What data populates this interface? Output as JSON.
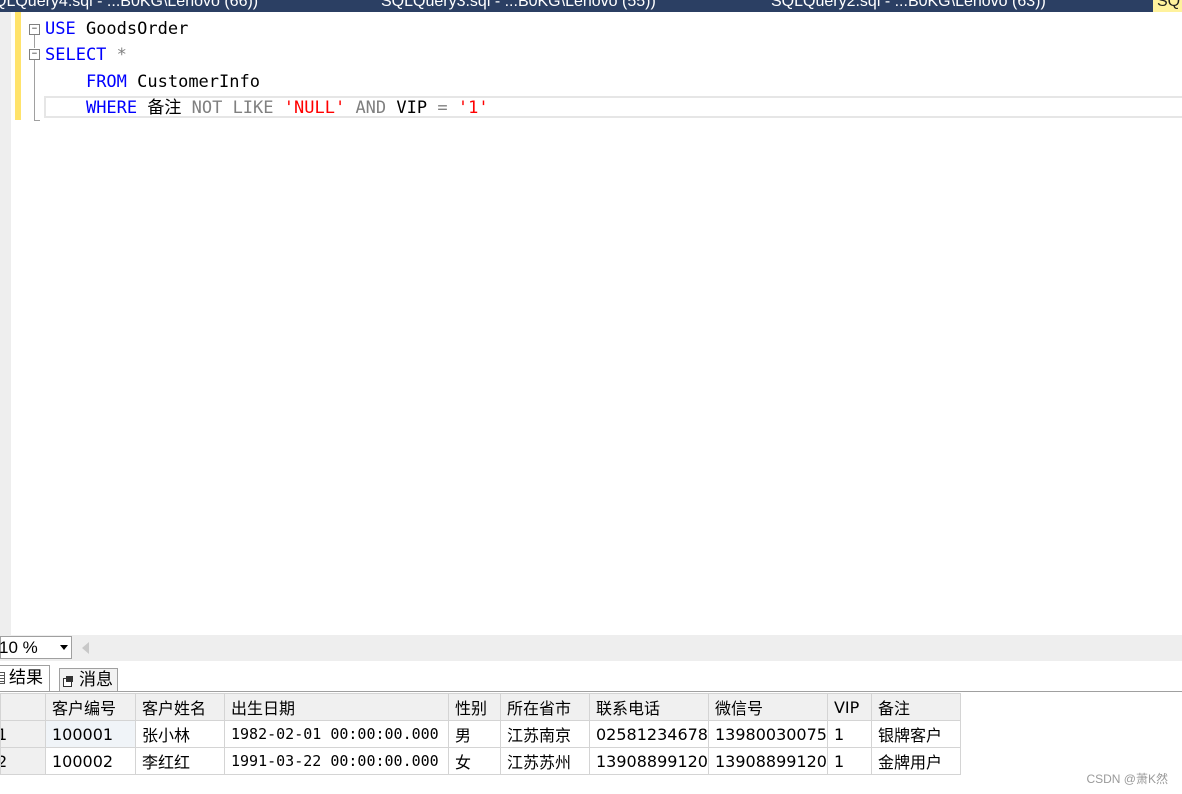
{
  "tabs": [
    {
      "label": "QLQuery4.sql - ...B0KG\\Lenovo (66))"
    },
    {
      "label": "SQLQuery3.sql - ...B0KG\\Lenovo (55))"
    },
    {
      "label": "SQLQuery2.sql - ...B0KG\\Lenovo (63))"
    },
    {
      "label": "SQ"
    }
  ],
  "editor": {
    "lines": [
      {
        "indent": "",
        "tokens": [
          {
            "t": "USE",
            "c": "kw"
          },
          {
            "t": " GoodsOrder",
            "c": ""
          }
        ]
      },
      {
        "indent": "",
        "tokens": [
          {
            "t": "SELECT",
            "c": "kw"
          },
          {
            "t": " *",
            "c": "gr"
          }
        ]
      },
      {
        "indent": "    ",
        "tokens": [
          {
            "t": "FROM",
            "c": "kw"
          },
          {
            "t": " CustomerInfo",
            "c": ""
          }
        ]
      },
      {
        "indent": "    ",
        "tokens": [
          {
            "t": "WHERE",
            "c": "kw"
          },
          {
            "t": " 备注 ",
            "c": ""
          },
          {
            "t": "NOT LIKE",
            "c": "gr"
          },
          {
            "t": " ",
            "c": ""
          },
          {
            "t": "'NULL'",
            "c": "str"
          },
          {
            "t": " ",
            "c": ""
          },
          {
            "t": "AND",
            "c": "gr"
          },
          {
            "t": " VIP ",
            "c": ""
          },
          {
            "t": "=",
            "c": "gr"
          },
          {
            "t": " ",
            "c": ""
          },
          {
            "t": "'1'",
            "c": "str"
          }
        ]
      }
    ]
  },
  "zoom": {
    "value": "10 %"
  },
  "result_tabs": {
    "results": "结果",
    "messages": "消息"
  },
  "grid": {
    "columns": [
      "客户编号",
      "客户姓名",
      "出生日期",
      "性别",
      "所在省市",
      "联系电话",
      "微信号",
      "VIP",
      "备注"
    ],
    "rows": [
      {
        "num": "1",
        "cells": [
          "100001",
          "张小林",
          "1982-02-01 00:00:00.000",
          "男",
          "江苏南京",
          "02581234678",
          "13980030075",
          "1",
          "银牌客户"
        ]
      },
      {
        "num": "2",
        "cells": [
          "100002",
          "李红红",
          "1991-03-22 00:00:00.000",
          "女",
          "江苏苏州",
          "13908899120",
          "13908899120",
          "1",
          "金牌用户"
        ]
      }
    ]
  },
  "watermark": "CSDN @萧K然"
}
